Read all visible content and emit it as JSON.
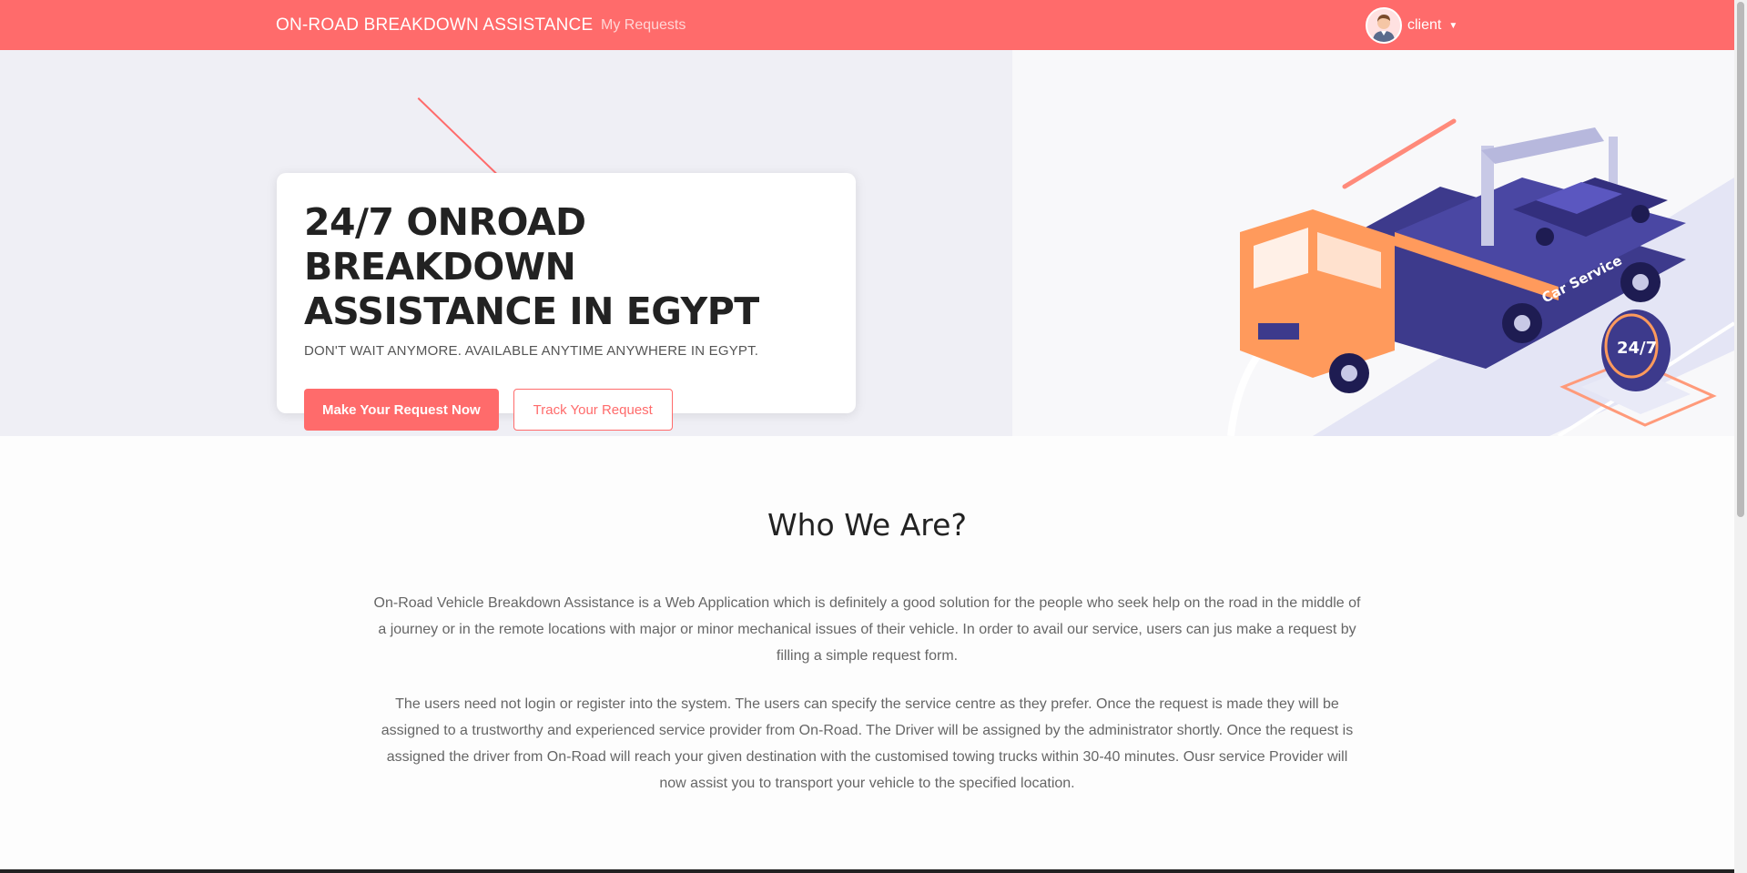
{
  "navbar": {
    "brand": "ON-ROAD BREAKDOWN ASSISTANCE",
    "link_requests": "My Requests",
    "user": {
      "name": "client",
      "avatar_icon": "user-avatar-icon"
    },
    "colors": {
      "background": "#ff6b6b",
      "text": "#ffffff"
    }
  },
  "hero": {
    "title": "24/7 ONROAD BREAKDOWN ASSISTANCE IN EGYPT",
    "subtitle": "DON'T WAIT ANYMORE. AVAILABLE ANYTIME ANYWHERE IN EGYPT.",
    "primary_button": "Make Your Request Now",
    "secondary_button": "Track Your Request",
    "illustration": {
      "truck_label": "Car Service",
      "badge": "24/7"
    },
    "colors": {
      "accent": "#ff6b6b",
      "truck_orange": "#ff9a5c",
      "truck_navy": "#3d3a8c"
    }
  },
  "about": {
    "title": "Who We Are?",
    "paragraph_1": "On-Road Vehicle Breakdown Assistance is a Web Application which is definitely a good solution for the people who seek help on the road in the middle of a journey or in the remote locations with major or minor mechanical issues of their vehicle. In order to avail our service, users can jus make a request by filling a simple request form.",
    "paragraph_2": "The users need not login or register into the system. The users can specify the service centre as they prefer. Once the request is made they will be assigned to a trustworthy and experienced service provider from On-Road. The Driver will be assigned by the administrator shortly. Once the request is assigned the driver from On-Road will reach your given destination with the customised towing trucks within 30-40 minutes. Ousr service Provider will now assist you to transport your vehicle to the specified location."
  }
}
